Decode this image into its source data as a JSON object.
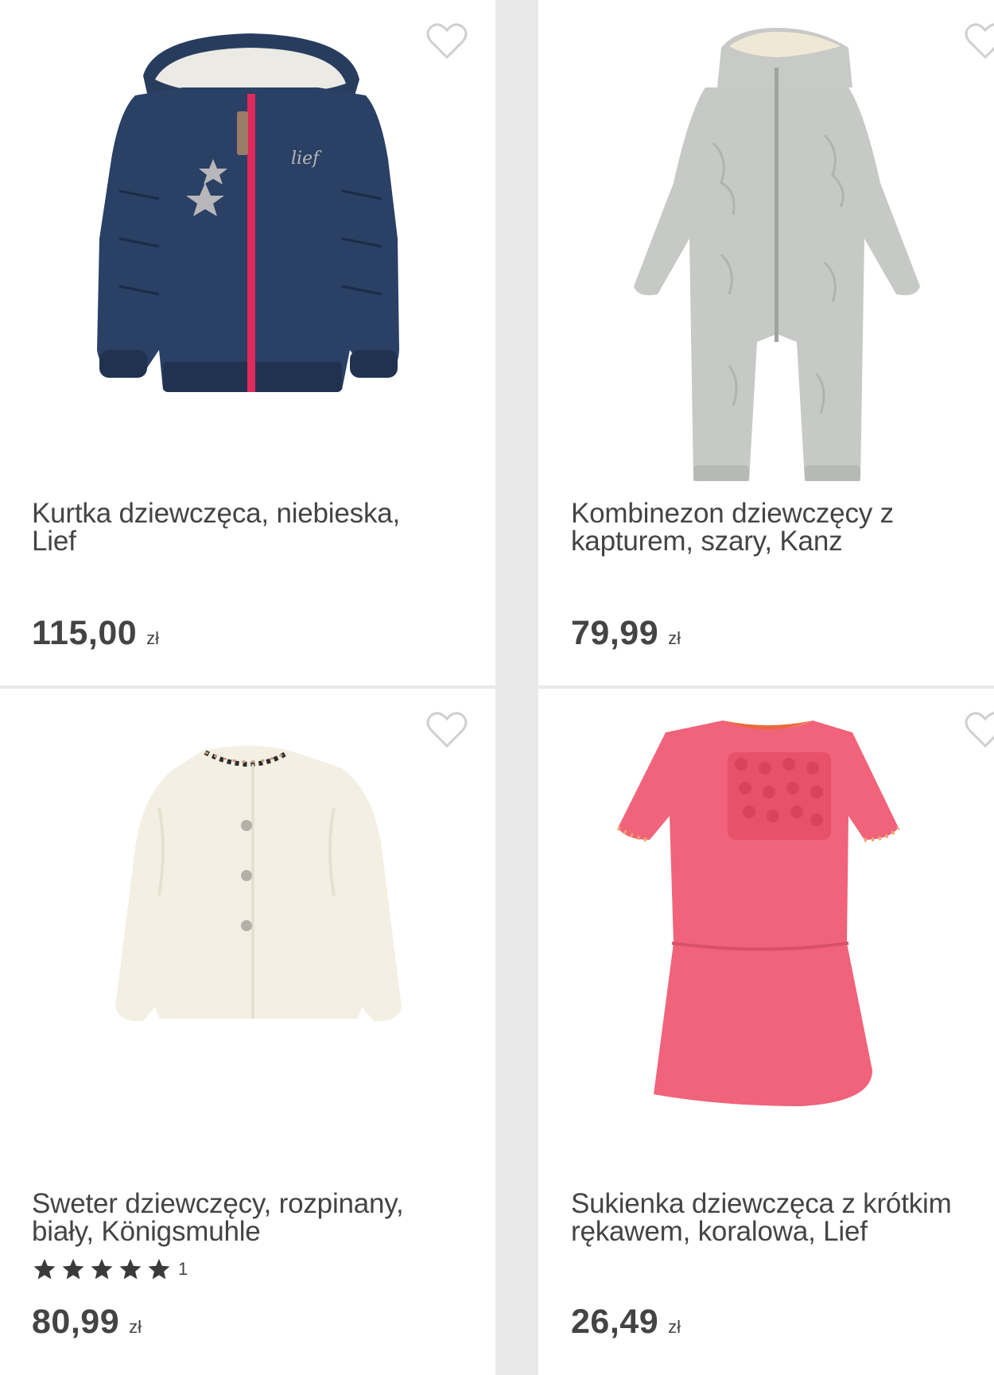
{
  "products": [
    {
      "name": "Kurtka dziewczęca, niebieska, Lief",
      "price": "115,00",
      "currency": "zł",
      "image_icon": "blue-jacket-image",
      "color": "#283d5e"
    },
    {
      "name": "Kombinezon dziewczęcy z kapturem, szary, Kanz",
      "price": "79,99",
      "currency": "zł",
      "image_icon": "grey-jumpsuit-image",
      "color": "#c7c9c6"
    },
    {
      "name": "Sweter dziewczęcy, rozpinany, biały, Königsmuhle",
      "rating": 5,
      "rating_max": 5,
      "review_count": "1",
      "price": "80,99",
      "currency": "zł",
      "image_icon": "white-cardigan-image",
      "color": "#f3efe2"
    },
    {
      "name": "Sukienka dziewczęca z krótkim rękawem, koralowa, Lief",
      "price": "26,49",
      "currency": "zł",
      "image_icon": "coral-dress-image",
      "color": "#f0637a"
    }
  ],
  "favorite_icon": "heart-outline-icon"
}
